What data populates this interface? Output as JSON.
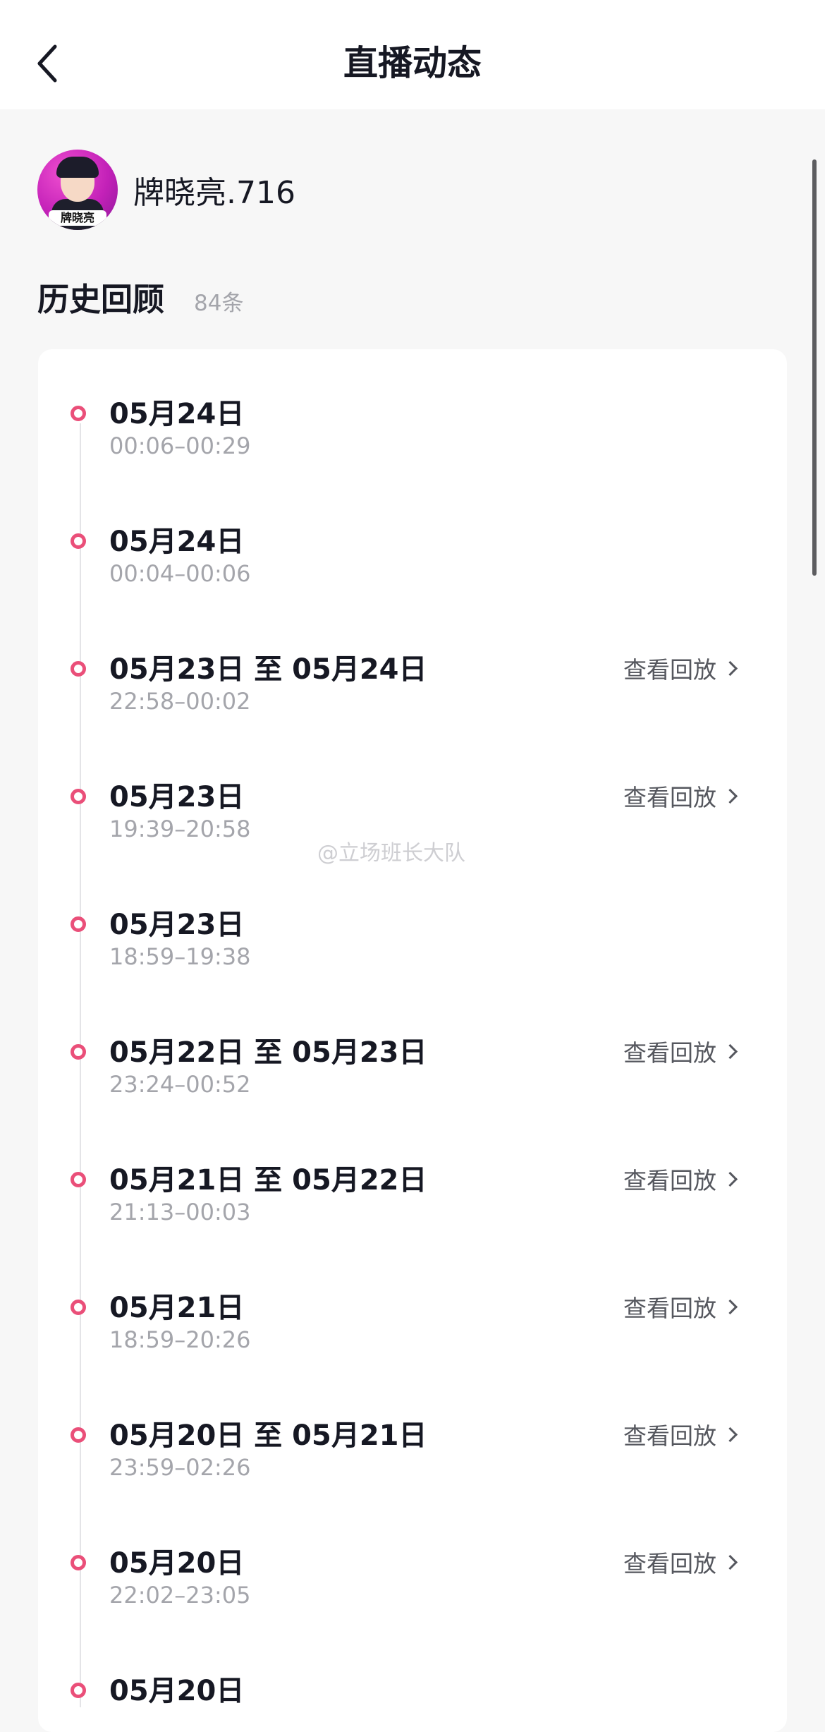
{
  "nav": {
    "title": "直播动态",
    "back_icon": "chevron-left-icon"
  },
  "profile": {
    "name": "牌晓亮.716",
    "avatar_tag": "牌晓亮"
  },
  "section": {
    "title": "历史回顾",
    "count": "84条"
  },
  "timeline": [
    {
      "date": "05月24日",
      "time": "00:06–00:29",
      "action": ""
    },
    {
      "date": "05月24日",
      "time": "00:04–00:06",
      "action": ""
    },
    {
      "date": "05月23日 至 05月24日",
      "time": "22:58–00:02",
      "action": "查看回放"
    },
    {
      "date": "05月23日",
      "time": "19:39–20:58",
      "action": "查看回放"
    },
    {
      "date": "05月23日",
      "time": "18:59–19:38",
      "action": ""
    },
    {
      "date": "05月22日 至 05月23日",
      "time": "23:24–00:52",
      "action": "查看回放"
    },
    {
      "date": "05月21日 至 05月22日",
      "time": "21:13–00:03",
      "action": "查看回放"
    },
    {
      "date": "05月21日",
      "time": "18:59–20:26",
      "action": "查看回放"
    },
    {
      "date": "05月20日 至 05月21日",
      "time": "23:59–02:26",
      "action": "查看回放"
    },
    {
      "date": "05月20日",
      "time": "22:02–23:05",
      "action": "查看回放"
    },
    {
      "date": "05月20日",
      "time": "",
      "action": ""
    }
  ],
  "watermark": "@立场班长大队",
  "colors": {
    "accent_dot": "#ea4f79",
    "page_bg": "#f7f7f7",
    "muted_text": "#a4a5ab"
  }
}
